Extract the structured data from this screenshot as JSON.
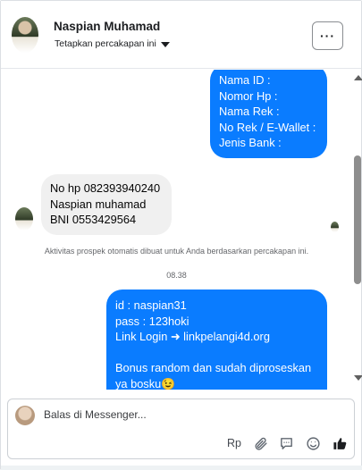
{
  "header": {
    "contact_name": "Naspian Muhamad",
    "conversation_setting": "Tetapkan percakapan ini",
    "more_label": "···"
  },
  "messages": [
    {
      "direction": "outgoing",
      "text": "Nama ID :\nNomor Hp :\nNama Rek :\nNo Rek / E-Wallet :\nJenis Bank :"
    },
    {
      "direction": "incoming",
      "text": "No hp 082393940240\nNaspian muhamad\nBNI 0553429564"
    },
    {
      "direction": "outgoing",
      "text": "id : naspian31\npass : 123hoki\nLink Login ➜ linkpelangi4d.org\n\nBonus random dan sudah diproseskan ya bosku😉"
    }
  ],
  "system_note": "Aktivitas prospek otomatis dibuat untuk Anda berdasarkan percakapan ini.",
  "timestamp": "08.38",
  "composer": {
    "placeholder": "Balas di Messenger...",
    "tools": [
      "Rp",
      "paperclip-icon",
      "chat-bubble-icon",
      "emoji-icon",
      "thumbs-up-icon"
    ],
    "rp_label": "Rp"
  },
  "colors": {
    "outgoing_bubble": "#0a7cff",
    "incoming_bubble": "#f0f0f0",
    "like_icon": "#1c1e21"
  }
}
